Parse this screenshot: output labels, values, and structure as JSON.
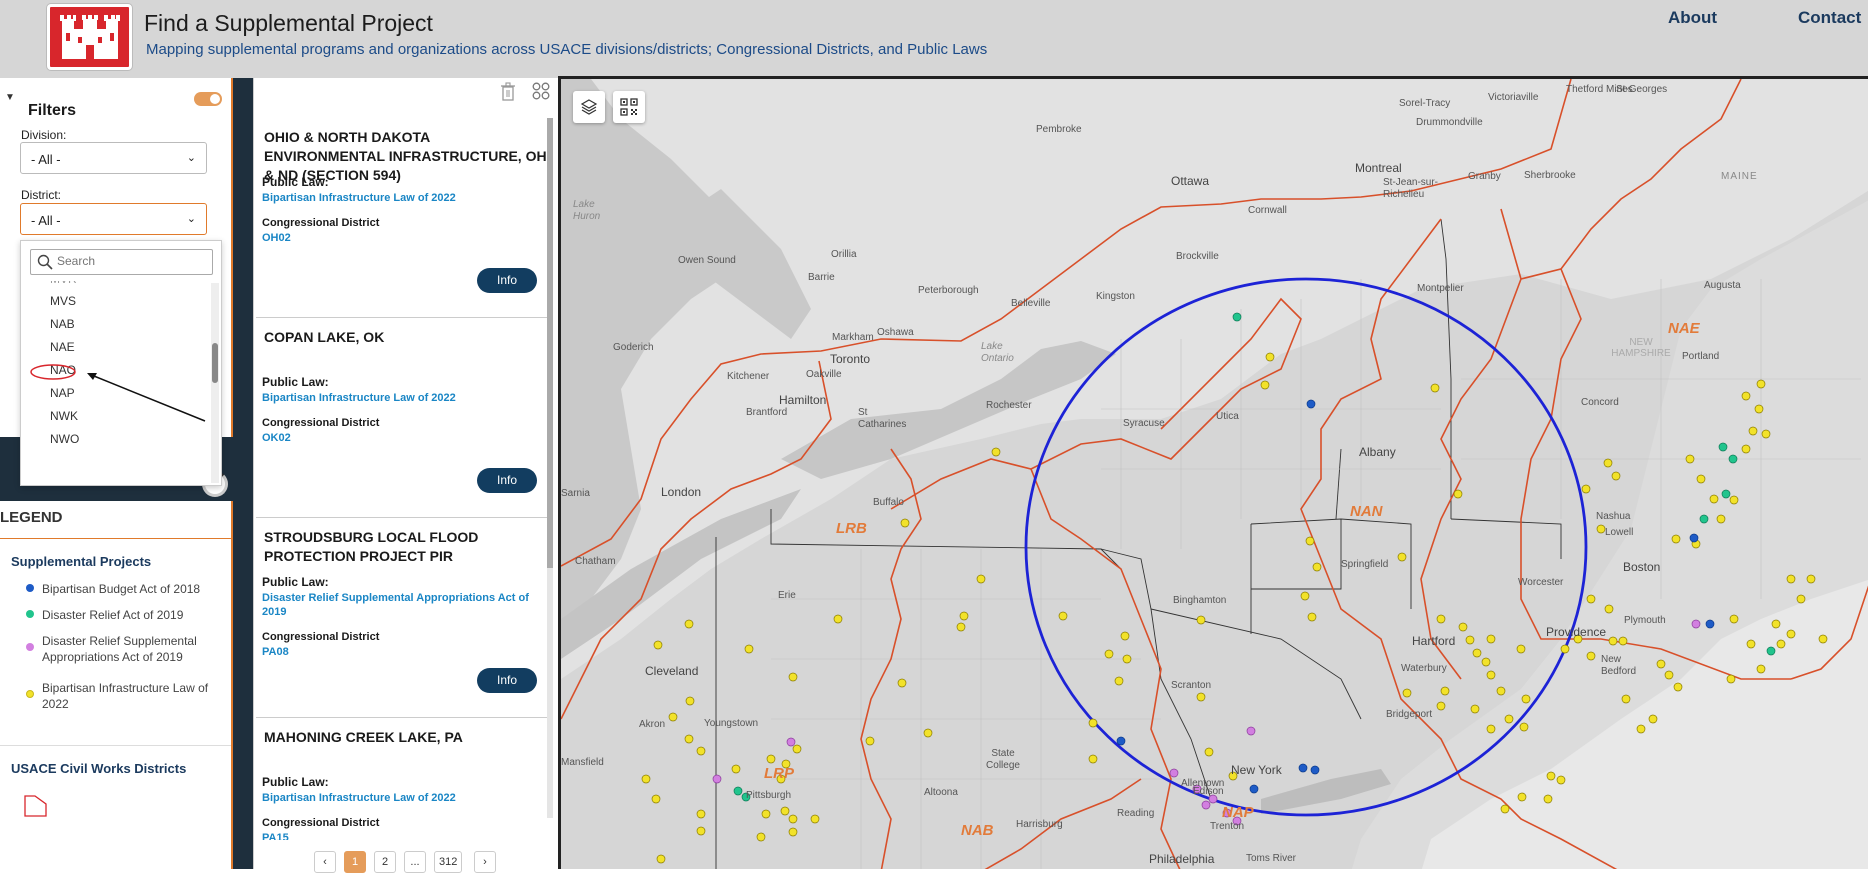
{
  "header": {
    "title": "Find a Supplemental Project",
    "subtitle": "Mapping supplemental programs and organizations across USACE divisions/districts; Congressional Districts, and Public Laws",
    "nav": {
      "about": "About",
      "contact": "Contact"
    }
  },
  "filters": {
    "title": "Filters",
    "division_label": "Division:",
    "division_value": "- All -",
    "district_label": "District:",
    "district_value": "- All -",
    "search_placeholder": "Search",
    "district_options": [
      "MVS",
      "NAB",
      "NAE",
      "NAO",
      "NAP",
      "NWK",
      "NWO"
    ]
  },
  "legend": {
    "title": "LEGEND",
    "projects_heading": "Supplemental Projects",
    "items": [
      {
        "label": "Bipartisan Budget Act of 2018",
        "color": "#1e5bc6"
      },
      {
        "label": "Disaster Relief Act of 2019",
        "color": "#21c48d"
      },
      {
        "label": "Disaster Relief Supplemental Appropriations Act of 2019",
        "color": "#d27fe0"
      },
      {
        "label": "Bipartisan Infrastructure Law of 2022",
        "color": "#f2e22a"
      }
    ],
    "districts_heading": "USACE Civil Works Districts"
  },
  "results": {
    "cards": [
      {
        "title": "OHIO & NORTH DAKOTA ENVIRONMENTAL INFRASTRUCTURE, OH & ND (SECTION 594)",
        "law_key": "Public Law:",
        "law": "Bipartisan Infrastructure Law of 2022",
        "cd_key": "Congressional District",
        "cd": "OH02",
        "btn": "Info"
      },
      {
        "title": "COPAN LAKE, OK",
        "law_key": "Public Law:",
        "law": "Bipartisan Infrastructure Law of 2022",
        "cd_key": "Congressional District",
        "cd": "OK02",
        "btn": "Info"
      },
      {
        "title": "STROUDSBURG LOCAL FLOOD PROTECTION PROJECT PIR",
        "law_key": "Public Law:",
        "law": "Disaster Relief Supplemental Appropriations Act of 2019",
        "cd_key": "Congressional District",
        "cd": "PA08",
        "btn": "Info"
      },
      {
        "title": "MAHONING CREEK LAKE, PA",
        "law_key": "Public Law:",
        "law": "Bipartisan Infrastructure Law of 2022",
        "cd_key": "Congressional District",
        "cd": "PA15",
        "btn": "Info"
      }
    ],
    "pager": {
      "prev": "‹",
      "current": "1",
      "next_page": "2",
      "ellipsis": "...",
      "last": "312",
      "next": "›"
    }
  },
  "map": {
    "places": [
      "Sorel-Tracy",
      "Victoriaville",
      "Thetford Mines",
      "St-Georges",
      "Drummondville",
      "Pembroke",
      "Ottawa",
      "Montreal",
      "St-Jean-sur-Richelieu",
      "Granby",
      "Sherbrooke",
      "MAINE",
      "Cornwall",
      "Lake Huron",
      "Owen Sound",
      "Orillia",
      "Brockville",
      "Barrie",
      "Peterborough",
      "Kingston",
      "Belleville",
      "Augusta",
      "Montpelier",
      "Markham",
      "Oshawa",
      "Toronto",
      "Lake Ontario",
      "Goderich",
      "Kitchener",
      "Oakville",
      "Hamilton",
      "Brantford",
      "St Catharines",
      "Rochester",
      "Syracuse",
      "Utica",
      "Albany",
      "NEW HAMPSHIRE",
      "Concord",
      "Portland",
      "London",
      "Sarnia",
      "Buffalo",
      "Nashua",
      "Lowell",
      "Boston",
      "Worcester",
      "Springfield",
      "Chatham",
      "Erie",
      "Binghamton",
      "Hartford",
      "Providence",
      "Plymouth",
      "Cleveland",
      "Waterbury",
      "New Bedford",
      "Youngstown",
      "Akron",
      "Scranton",
      "Bridgeport",
      "Mansfield",
      "State College",
      "Pittsburgh",
      "Allentown",
      "New York",
      "Edison",
      "Altoona",
      "Reading",
      "Trenton",
      "Harrisburg",
      "Philadelphia",
      "Toms River"
    ],
    "district_labels": [
      "NAE",
      "NAN",
      "LRB",
      "LRP",
      "NAB",
      "NAP"
    ]
  }
}
